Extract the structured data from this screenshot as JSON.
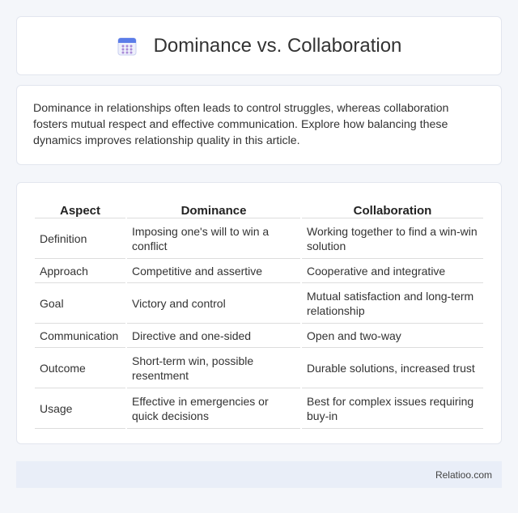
{
  "header": {
    "title": "Dominance vs. Collaboration",
    "icon": "calendar-icon",
    "icon_colors": {
      "top": "#5b7de8",
      "body": "#eef0fb",
      "dots": "#a98ad8"
    }
  },
  "intro": {
    "text": "Dominance in relationships often leads to control struggles, whereas collaboration fosters mutual respect and effective communication. Explore how balancing these dynamics improves relationship quality in this article."
  },
  "table": {
    "headers": [
      "Aspect",
      "Dominance",
      "Collaboration"
    ],
    "rows": [
      {
        "aspect": "Definition",
        "dominance": "Imposing one's will to win a conflict",
        "collaboration": "Working together to find a win-win solution"
      },
      {
        "aspect": "Approach",
        "dominance": "Competitive and assertive",
        "collaboration": "Cooperative and integrative"
      },
      {
        "aspect": "Goal",
        "dominance": "Victory and control",
        "collaboration": "Mutual satisfaction and long-term relationship"
      },
      {
        "aspect": "Communication",
        "dominance": "Directive and one-sided",
        "collaboration": "Open and two-way"
      },
      {
        "aspect": "Outcome",
        "dominance": "Short-term win, possible resentment",
        "collaboration": "Durable solutions, increased trust"
      },
      {
        "aspect": "Usage",
        "dominance": "Effective in emergencies or quick decisions",
        "collaboration": "Best for complex issues requiring buy-in"
      }
    ]
  },
  "footer": {
    "brand": "Relatioo.com"
  }
}
